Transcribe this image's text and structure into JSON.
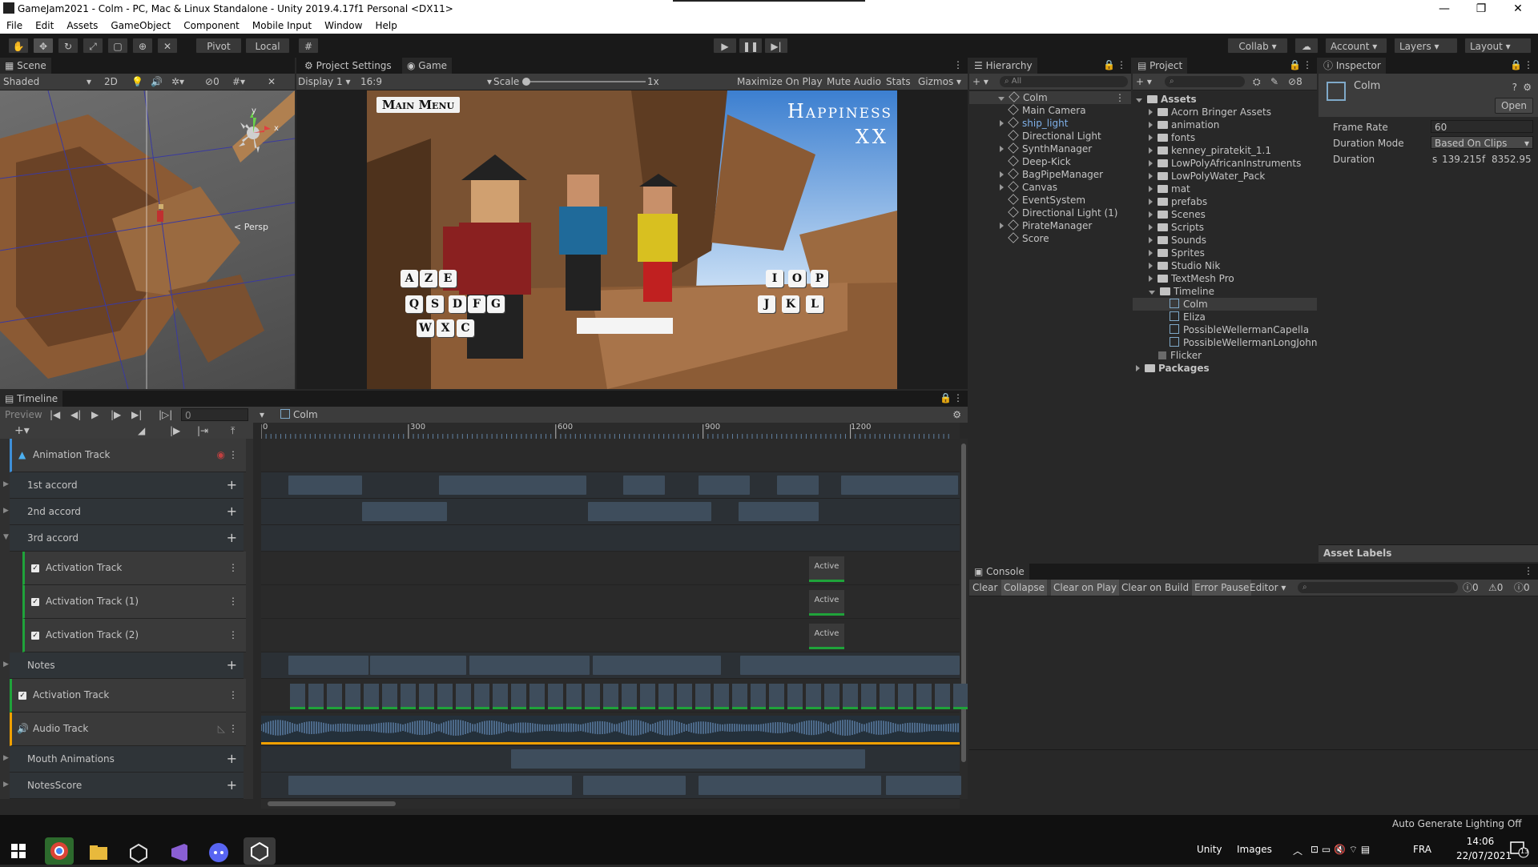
{
  "window": {
    "title": "GameJam2021 - Colm - PC, Mac & Linux Standalone - Unity 2019.4.17f1 Personal <DX11>",
    "minimize": "—",
    "maximize": "❐",
    "close": "✕"
  },
  "menu": [
    "File",
    "Edit",
    "Assets",
    "GameObject",
    "Component",
    "Mobile Input",
    "Window",
    "Help"
  ],
  "toolbar": {
    "pivot": "Pivot",
    "local": "Local",
    "collab": "Collab ▾",
    "account": "Account",
    "layers": "Layers",
    "layout": "Layout"
  },
  "scene": {
    "tab": "Scene",
    "shading": "Shaded",
    "mode2d": "2D",
    "gizmo_count": "0",
    "persp": "< Persp",
    "axis_x": "x",
    "axis_y": "y"
  },
  "project_settings_tab": "Project Settings",
  "game": {
    "tab": "Game",
    "display": "Display 1",
    "aspect": "16:9",
    "scale_label": "Scale",
    "scale_value": "1x",
    "maximize": "Maximize On Play",
    "mute": "Mute Audio",
    "stats": "Stats",
    "gizmos": "Gizmos",
    "main_menu": "Main Menu",
    "happiness": "Happiness",
    "score": "XX",
    "keys_left": [
      [
        "A",
        "Z",
        "E"
      ],
      [
        "Q",
        "S",
        "D",
        "F",
        "G"
      ],
      [
        "W",
        "X",
        "C"
      ]
    ],
    "keys_right": [
      [
        "I",
        "O",
        "P"
      ],
      [
        "J",
        "K",
        "L"
      ]
    ]
  },
  "hierarchy": {
    "tab": "Hierarchy",
    "search_placeholder": "All",
    "root": "Colm",
    "items": [
      "Main Camera",
      "ship_light",
      "Directional Light",
      "SynthManager",
      "Deep-Kick",
      "BagPipeManager",
      "Canvas",
      "EventSystem",
      "Directional Light (1)",
      "PirateManager",
      "Score"
    ]
  },
  "project": {
    "tab": "Project",
    "hidden_count": "8",
    "assets_root": "Assets",
    "folders": [
      "Acorn Bringer Assets",
      "animation",
      "fonts",
      "kenney_piratekit_1.1",
      "LowPolyAfricanInstruments",
      "LowPolyWater_Pack",
      "mat",
      "prefabs",
      "Scenes",
      "Scripts",
      "Sounds",
      "Sprites",
      "Studio Nik",
      "TextMesh Pro",
      "Timeline"
    ],
    "timeline_children": [
      "Colm",
      "Eliza",
      "PossibleWellermanCapella",
      "PossibleWellermanLongJohn"
    ],
    "after": [
      "Flicker"
    ],
    "packages": "Packages"
  },
  "inspector": {
    "tab": "Inspector",
    "asset_name": "Colm",
    "open": "Open",
    "frame_rate_label": "Frame Rate",
    "frame_rate": "60",
    "duration_mode_label": "Duration Mode",
    "duration_mode": "Based On Clips",
    "duration_label": "Duration",
    "duration_s": "139.215",
    "duration_f": "8352.95",
    "s_label": "s",
    "f_label": "f",
    "asset_labels": "Asset Labels"
  },
  "console": {
    "tab": "Console",
    "buttons": [
      "Clear",
      "Collapse",
      "Clear on Play",
      "Clear on Build",
      "Error Pause",
      "Editor ▾"
    ],
    "counts": [
      "0",
      "0",
      "0"
    ]
  },
  "timeline": {
    "tab": "Timeline",
    "preview": "Preview",
    "frame": "0",
    "asset": "Colm",
    "ruler": [
      "0",
      "300",
      "600",
      "900",
      "1200"
    ],
    "tracks": [
      {
        "label": "Animation Track",
        "type": "anim"
      },
      {
        "label": "1st accord",
        "type": "group"
      },
      {
        "label": "2nd accord",
        "type": "group"
      },
      {
        "label": "3rd accord",
        "type": "group"
      },
      {
        "label": "Activation Track",
        "type": "act-sub"
      },
      {
        "label": "Activation Track (1)",
        "type": "act-sub"
      },
      {
        "label": "Activation Track (2)",
        "type": "act-sub"
      },
      {
        "label": "Notes",
        "type": "group"
      },
      {
        "label": "Activation Track",
        "type": "act"
      },
      {
        "label": "Audio Track",
        "type": "audio"
      },
      {
        "label": "Mouth Animations",
        "type": "group"
      },
      {
        "label": "NotesScore",
        "type": "group"
      }
    ],
    "active_label": "Active"
  },
  "status": {
    "lighting": "Auto Generate Lighting Off"
  },
  "taskbar": {
    "unity": "Unity",
    "images": "Images",
    "lang": "FRA",
    "time": "14:06",
    "date": "22/07/2021",
    "notifications": "13"
  },
  "colors": {
    "accent": "#3d6ea8",
    "track_green": "#1fa33a",
    "audio_orange": "#f0a000"
  }
}
